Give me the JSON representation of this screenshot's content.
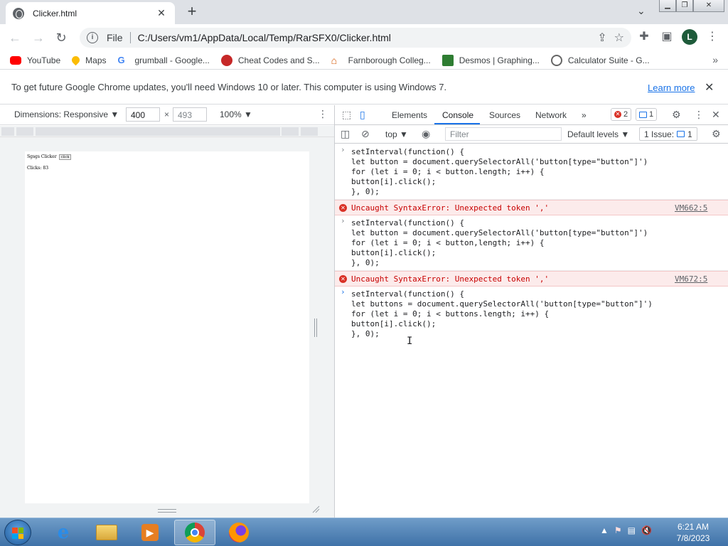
{
  "browser": {
    "tab_title": "Clicker.html",
    "tab_close": "✕",
    "new_tab": "+",
    "url_scheme": "File",
    "url": "C:/Users/vm1/AppData/Local/Temp/RarSFX0/Clicker.html",
    "profile_initial": "L"
  },
  "bookmarks": [
    {
      "label": "YouTube",
      "icon": "youtube-icon",
      "color": "#ff0000"
    },
    {
      "label": "Maps",
      "icon": "maps-pin-icon",
      "color": "#fbbc04"
    },
    {
      "label": "grumball - Google...",
      "icon": "google-g-icon",
      "color": "#4285f4"
    },
    {
      "label": "Cheat Codes and S...",
      "icon": "gamepad-icon",
      "color": "#c62828"
    },
    {
      "label": "Farnborough Colleg...",
      "icon": "college-icon",
      "color": "#d35400"
    },
    {
      "label": "Desmos | Graphing...",
      "icon": "desmos-icon",
      "color": "#2e7d32"
    },
    {
      "label": "Calculator Suite - G...",
      "icon": "geogebra-icon",
      "color": "#666666"
    }
  ],
  "infobar": {
    "message": "To get future Google Chrome updates, you'll need Windows 10 or later. This computer is using Windows 7.",
    "learn_more": "Learn more"
  },
  "device_toolbar": {
    "dimensions": "Dimensions: Responsive ▼",
    "width": "400",
    "height": "493",
    "times": "×",
    "zoom": "100% ▼"
  },
  "page": {
    "title_text": "Sgsgs Clicker",
    "click_button": "click",
    "clicks_label": "Clicks: 83"
  },
  "devtools": {
    "tabs": [
      "Elements",
      "Console",
      "Sources",
      "Network"
    ],
    "more_tabs": "»",
    "error_count": "2",
    "message_count": "1",
    "context": "top ▼",
    "filter_placeholder": "Filter",
    "levels": "Default levels ▼",
    "issues_label": "1 Issue:",
    "issues_count": "1"
  },
  "console": {
    "entries": [
      {
        "lines": [
          "setInterval(function() {",
          "let button = document.querySelectorAll('button[type=\"button\"]')",
          "for (let i = 0; i < button.length; i++) {",
          "button[i].click();",
          "}, 0);"
        ],
        "error": "Uncaught SyntaxError: Unexpected token ','",
        "error_location": "VM662:5"
      },
      {
        "lines": [
          "setInterval(function() {",
          "let button = document.querySelectorAll('button[type=\"button\"]')",
          "for (let i = 0; i < button,length; i++) {",
          "button[i].click();",
          "}, 0);"
        ],
        "error": "Uncaught SyntaxError: Unexpected token ','",
        "error_location": "VM672:5"
      },
      {
        "lines": [
          "setInterval(function() {",
          "let buttons = document.querySelectorAll('button[type=\"button\"]')",
          "for (let i = 0; i < buttons.length; i++) {",
          "button[i].click();",
          "}, 0);"
        ]
      }
    ]
  },
  "taskbar": {
    "time": "6:21 AM",
    "date": "7/8/2023",
    "apps": [
      "internet-explorer-icon",
      "file-explorer-icon",
      "media-player-icon",
      "chrome-icon",
      "firefox-icon"
    ]
  }
}
